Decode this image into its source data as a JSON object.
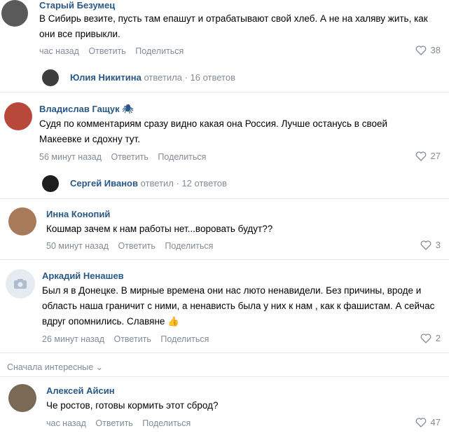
{
  "comments": [
    {
      "author": "Старый Безумец",
      "text": "В Сибирь везите, пусть там епашут и отрабатывают свой хлеб. А не на халяву жить, как они все привыкли.",
      "time": "час назад",
      "reply": "Ответить",
      "share": "Поделиться",
      "likes": "38",
      "thread": {
        "name": "Юлия Никитина",
        "info": "ответила · 16 ответов"
      }
    },
    {
      "author": "Владислав Гащук 🕷",
      "text": "Судя по комментариям сразу видно какая она Россия. Лучше останусь в своей Макеевке и сдохну тут.",
      "time": "56 минут назад",
      "reply": "Ответить",
      "share": "Поделиться",
      "likes": "27",
      "thread": {
        "name": "Сергей Иванов",
        "info": "ответил · 12 ответов"
      }
    },
    {
      "author": "Инна Конопий",
      "text": "Кошмар зачем к нам работы нет...воровать будут??",
      "time": "50 минут назад",
      "reply": "Ответить",
      "share": "Поделиться",
      "likes": "3"
    },
    {
      "author": "Аркадий Ненашев",
      "text": "Был я в Донецке. В мирные времена они нас люто ненавидели. Без причины, вроде и область наша граничит с ними, а ненависть была у них к нам , как к фашистам. А сейчас вдруг опомнились. Славяне 👍",
      "time": "26 минут назад",
      "reply": "Ответить",
      "share": "Поделиться",
      "likes": "2"
    }
  ],
  "sort_label": "Сначала интересные ⌄",
  "last_comment": {
    "author": "Алексей Айсин",
    "text": "Че ростов, готовы кормить этот сброд?",
    "time": "час назад",
    "reply": "Ответить",
    "share": "Поделиться",
    "likes": "47"
  },
  "colors": {
    "link": "#2a5885",
    "meta": "#818c99",
    "divider": "#e7e8ec"
  }
}
